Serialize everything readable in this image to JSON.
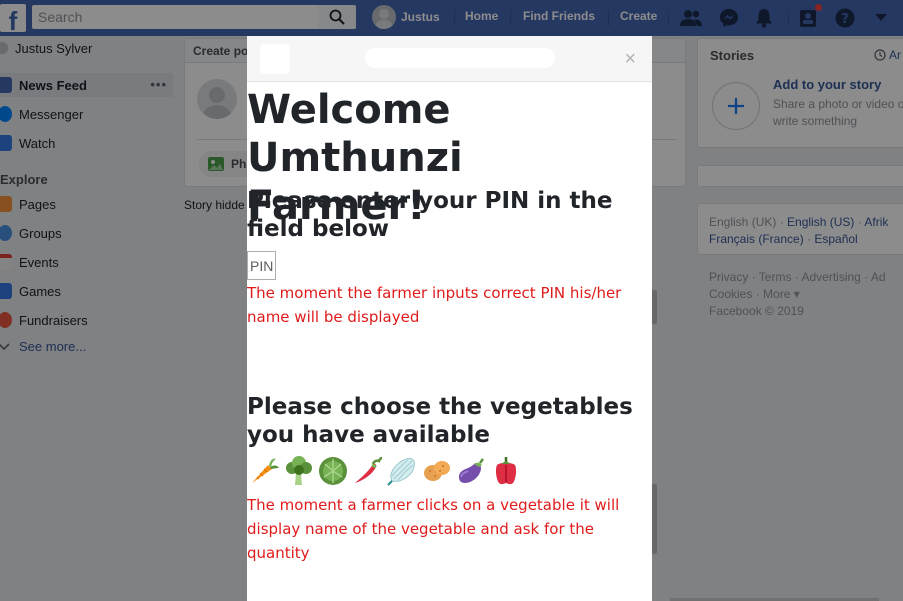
{
  "topbar": {
    "search_placeholder": "Search",
    "user_name": "Justus",
    "home": "Home",
    "find_friends": "Find Friends",
    "create": "Create"
  },
  "left_nav": {
    "profile": "Justus Sylver",
    "news_feed": "News Feed",
    "messenger": "Messenger",
    "watch": "Watch",
    "explore": "Explore",
    "pages": "Pages",
    "groups": "Groups",
    "events": "Events",
    "games": "Games",
    "fundraisers": "Fundraisers",
    "see_more": "See more..."
  },
  "center": {
    "create_post": "Create po",
    "photo": "Ph",
    "story_hidden": "Story hidde"
  },
  "right": {
    "stories_title": "Stories",
    "archive": "Ar",
    "add_story_title": "Add to your story",
    "add_story_sub": "Share a photo or video or write something",
    "lang_1": "English (UK)",
    "lang_2": "English (US)",
    "lang_3": "Afrik",
    "lang_4": "Français (France)",
    "lang_5": "Español",
    "footer_1": "Privacy",
    "footer_2": "Terms",
    "footer_3": "Advertising",
    "footer_4": "Ad",
    "footer_5": "Cookies",
    "footer_6": "More",
    "copyright": "Facebook © 2019"
  },
  "modal": {
    "close_glyph": "×",
    "welcome": "Welcome Umthunzi Farmer!",
    "pin_heading": "Please enter your PIN in the field below",
    "pin_placeholder": "PIN",
    "pin_note": "The moment the farmer inputs correct PIN his/her name will be displayed",
    "veg_heading": "Please choose the vegetables you have available",
    "veg_note": "The moment a farmer clicks on a vegetable it will display name of the vegetable and ask for the quantity",
    "vegetables": [
      "carrot-icon",
      "broccoli-icon",
      "lettuce-icon",
      "chili-icon",
      "garlic-icon",
      "potato-icon",
      "eggplant-icon",
      "bell-pepper-icon"
    ]
  },
  "colors": {
    "facebook_blue": "#4267b2",
    "link_blue": "#385898",
    "note_red": "#e01b1b",
    "page_bg": "#e9ebee"
  }
}
